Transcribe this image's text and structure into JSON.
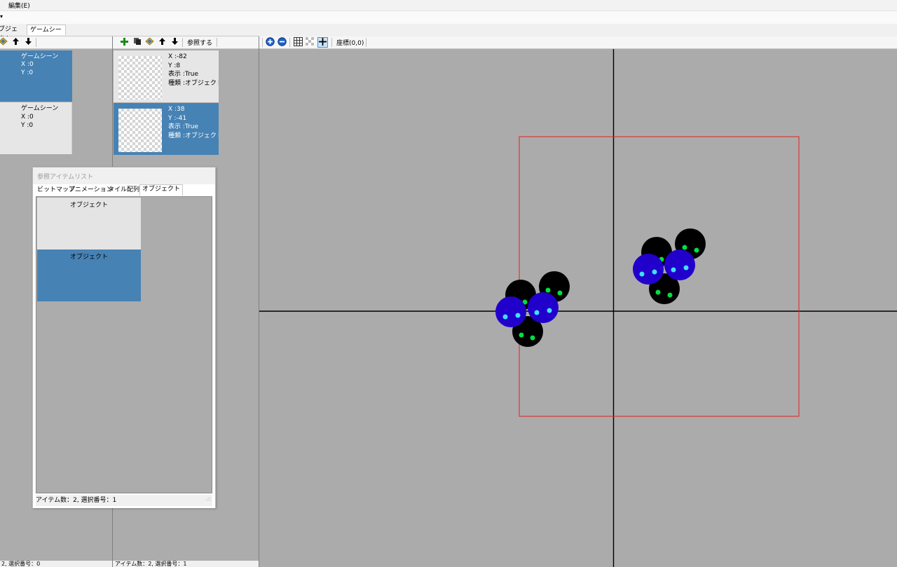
{
  "menubar": {
    "edit": "編集(E)"
  },
  "strip2": {
    "caret": "▾"
  },
  "tabs": [
    {
      "label": "ブジェクト"
    },
    {
      "label": "ゲームシーン"
    }
  ],
  "left_toolbar": {
    "icons": [
      "add-icon",
      "arrow-up-icon",
      "arrow-down-icon"
    ]
  },
  "scenes": [
    {
      "title": "ゲームシーン",
      "x": "X  :0",
      "y": "Y  :0",
      "selected": true
    },
    {
      "title": "ゲームシーン",
      "x": "X  :0",
      "y": "Y  :0",
      "selected": false
    }
  ],
  "mid_toolbar": {
    "ref_label": "参照する"
  },
  "objects": [
    {
      "x": "X  :-82",
      "y": "Y  :8",
      "visible": "表示  :True",
      "kind": "種類 :オブジェクトア",
      "selected": false
    },
    {
      "x": "X  :38",
      "y": "Y  :-41",
      "visible": "表示  :True",
      "kind": "種類 :オブジェクトア",
      "selected": true
    }
  ],
  "canvas_toolbar": {
    "coord_label": "座標(0,0)"
  },
  "dialog": {
    "title": "参照アイテムリスト",
    "tabs": [
      "ビットマップ",
      "アニメーション",
      "タイル配列",
      "オブジェクト"
    ],
    "active_tab": 3,
    "items": [
      {
        "label": "オブジェクト",
        "selected": false
      },
      {
        "label": "オブジェクト",
        "selected": true
      }
    ],
    "status": "アイテム数：2, 選択番号：1",
    "grip": ".::"
  },
  "status_left": "2, 選択番号：0",
  "status_mid": "アイテム数：2, 選択番号：1",
  "colors": {
    "selected": "#4682b4",
    "panel": "#acacac",
    "canvas": "#ababab",
    "frame": "#e02020",
    "sprite_body": "#000000",
    "sprite_blue": "#2200cc",
    "eye_green": "#00e040",
    "eye_cyan": "#40e0ff"
  }
}
